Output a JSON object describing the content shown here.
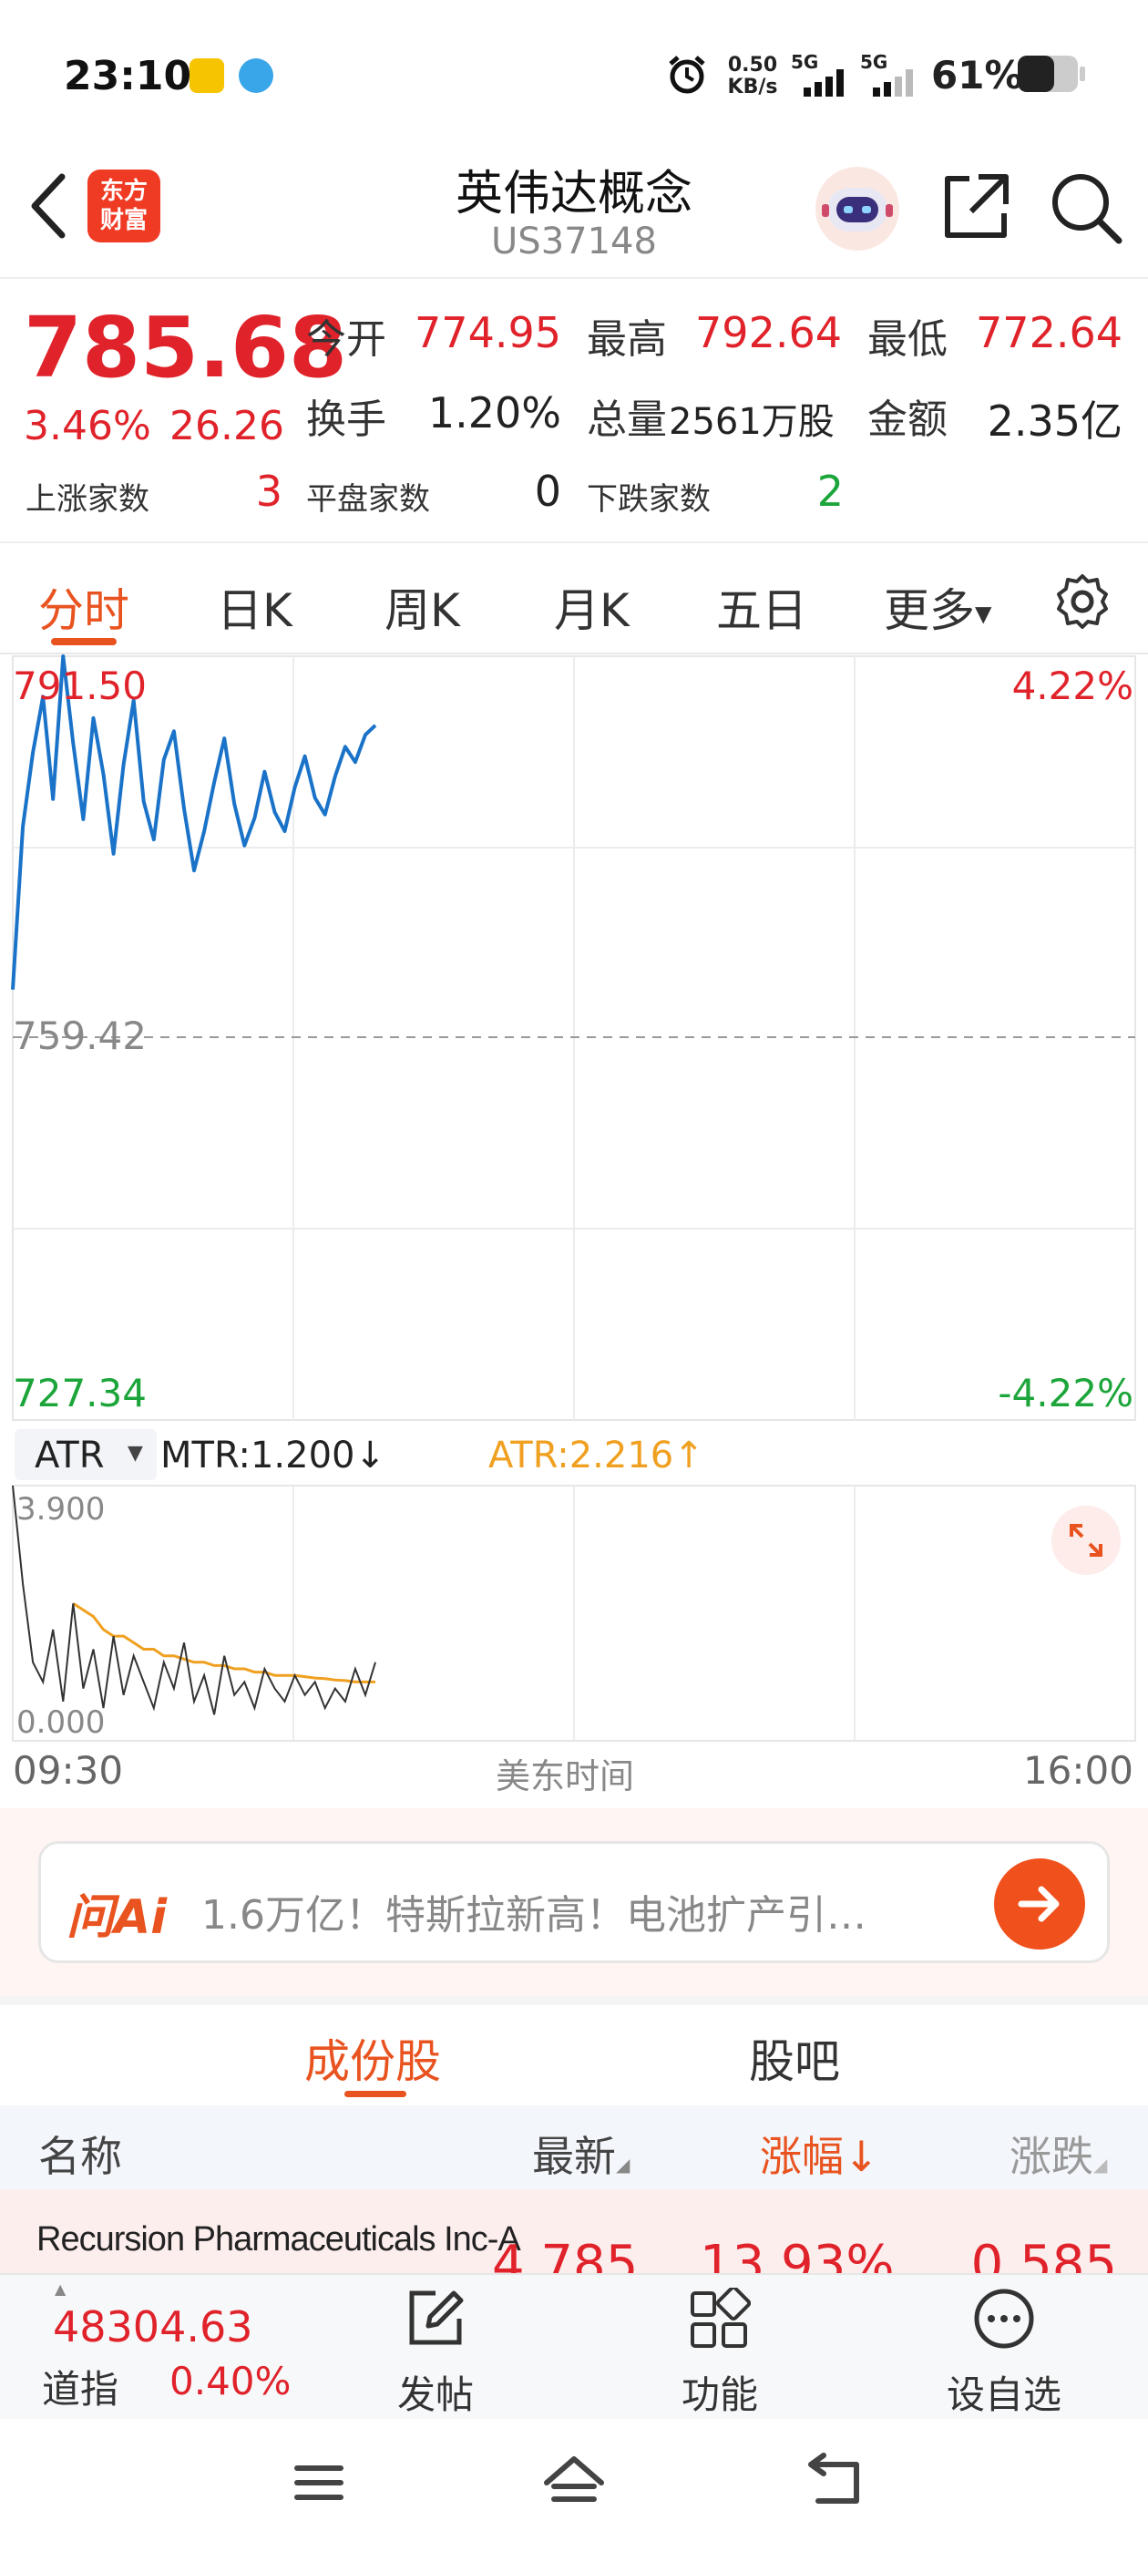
{
  "status_bar": {
    "time": "23:10",
    "net_speed_value": "0.50",
    "net_speed_unit": "KB/s",
    "sim1": "5G",
    "sim2": "5G",
    "battery": "61%"
  },
  "header": {
    "logo_line1": "东方",
    "logo_line2": "财富",
    "title": "英伟达概念",
    "code": "US37148"
  },
  "quote": {
    "price": "785.68",
    "change_pct": "3.46%",
    "change": "26.26",
    "open_label": "今开",
    "open": "774.95",
    "high_label": "最高",
    "high": "792.64",
    "low_label": "最低",
    "low": "772.64",
    "turnover_label": "换手",
    "turnover": "1.20%",
    "volume_label": "总量",
    "volume": "2561万股",
    "amount_label": "金额",
    "amount": "2.35亿",
    "up_label": "上涨家数",
    "up_count": "3",
    "flat_label": "平盘家数",
    "flat_count": "0",
    "down_label": "下跌家数",
    "down_count": "2"
  },
  "chart_tabs": {
    "items": [
      "分时",
      "日K",
      "周K",
      "月K",
      "五日",
      "更多"
    ],
    "active": "分时"
  },
  "indicator": {
    "name": "ATR",
    "mtr": "MTR:1.200",
    "mtr_arrow": "↓",
    "atr": "ATR:2.216",
    "atr_arrow": "↑"
  },
  "colors": {
    "up": "#e0222a",
    "down": "#1ca53a",
    "accent": "#e8531f",
    "price_line": "#1a73c8",
    "atr_line": "#f0a020"
  },
  "chart_data": [
    {
      "type": "line",
      "x_range": [
        "09:30",
        "16:00"
      ],
      "x_label": "美东时间",
      "ylim": [
        727.34,
        791.5
      ],
      "y_ticks": [
        "791.50",
        "759.42",
        "727.34"
      ],
      "right_ticks": [
        "4.22%",
        "-4.22%"
      ],
      "prev_close": 759.42,
      "grid": true,
      "series": [
        {
          "values": [
            763.5,
            777.2,
            783.4,
            788.1,
            779.5,
            791.5,
            784.2,
            777.8,
            786.3,
            781.6,
            774.9,
            782.4,
            787.8,
            779.3,
            776.1,
            782.8,
            785.2,
            778.7,
            773.5,
            776.8,
            780.9,
            784.6,
            779.1,
            775.6,
            777.9,
            781.8,
            778.4,
            776.8,
            780.5,
            783.1,
            779.6,
            778.2,
            781.4,
            783.9,
            782.6,
            784.9,
            785.7
          ]
        }
      ]
    },
    {
      "type": "line",
      "ylim": [
        0,
        3.9
      ],
      "y_ticks": [
        "3.900",
        "0.000"
      ],
      "grid": true,
      "series": [
        {
          "name": "MTR",
          "values": [
            3.9,
            2.4,
            1.2,
            0.9,
            1.7,
            0.6,
            2.1,
            0.8,
            1.4,
            0.5,
            1.6,
            0.7,
            1.3,
            0.9,
            0.5,
            1.2,
            0.8,
            1.5,
            0.6,
            1.0,
            0.4,
            1.3,
            0.7,
            0.9,
            0.5,
            1.1,
            0.8,
            0.6,
            1.0,
            0.7,
            0.9,
            0.5,
            0.8,
            0.6,
            1.1,
            0.7,
            1.2
          ]
        },
        {
          "name": "ATR",
          "values": [
            null,
            null,
            null,
            null,
            null,
            null,
            2.1,
            2.0,
            1.9,
            1.7,
            1.6,
            1.6,
            1.5,
            1.4,
            1.4,
            1.3,
            1.3,
            1.25,
            1.2,
            1.2,
            1.15,
            1.15,
            1.1,
            1.1,
            1.05,
            1.05,
            1.0,
            1.0,
            1.0,
            0.98,
            0.96,
            0.95,
            0.93,
            0.92,
            0.9,
            0.9,
            0.9
          ]
        }
      ]
    }
  ],
  "ai_banner": {
    "logo": "问Ai",
    "text": "1.6万亿！特斯拉新高！电池扩产引…"
  },
  "sub_tabs": {
    "items": [
      "成份股",
      "股吧"
    ],
    "active": "成份股"
  },
  "table": {
    "headers": [
      "名称",
      "最新",
      "涨幅",
      "涨跌"
    ],
    "rows": [
      {
        "name": "Recursion Pharmaceuticals Inc-A",
        "last": "4.785",
        "pct": "13.93%",
        "chg": "0.585"
      }
    ]
  },
  "bottom_bar": {
    "index_value": "48304.63",
    "index_name": "道指",
    "index_change": "0.40%",
    "items": [
      "发帖",
      "功能",
      "设自选"
    ]
  }
}
